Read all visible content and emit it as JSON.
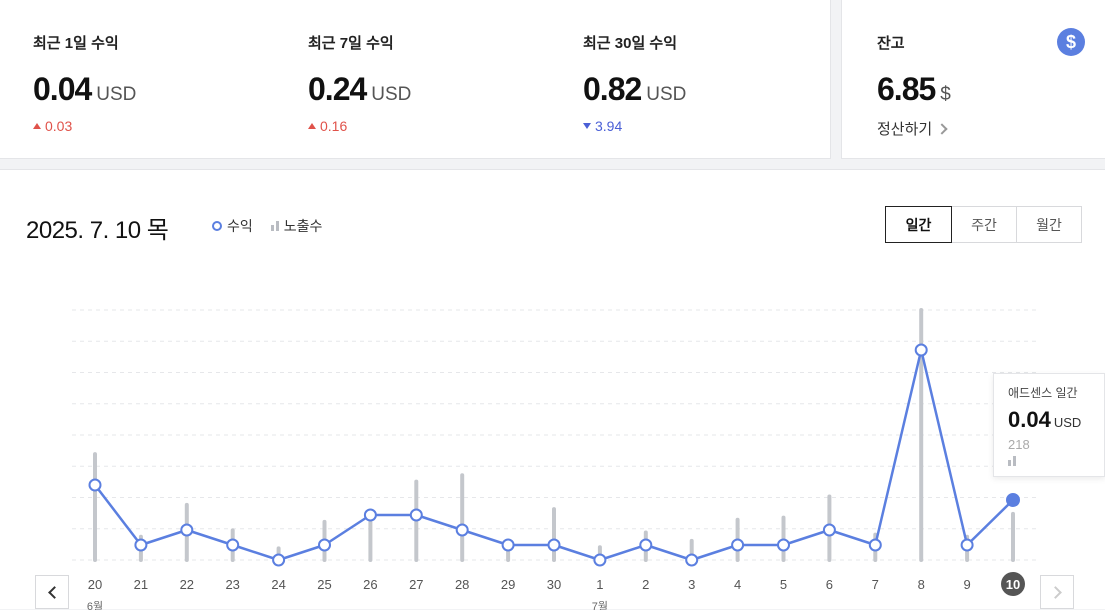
{
  "stats": [
    {
      "label": "최근 1일 수익",
      "value": "0.04",
      "unit": "USD",
      "delta": "0.03",
      "direction": "up"
    },
    {
      "label": "최근 7일 수익",
      "value": "0.24",
      "unit": "USD",
      "delta": "0.16",
      "direction": "up"
    },
    {
      "label": "최근 30일 수익",
      "value": "0.82",
      "unit": "USD",
      "delta": "3.94",
      "direction": "down"
    }
  ],
  "balance": {
    "label": "잔고",
    "value": "6.85",
    "unit": "$",
    "settle_label": "정산하기",
    "icon": "$"
  },
  "panel": {
    "date_title": "2025. 7. 10 목",
    "legend_revenue": "수익",
    "legend_impressions": "노출수",
    "segments": [
      "일간",
      "주간",
      "월간"
    ],
    "active_segment": 0
  },
  "tooltip": {
    "title": "애드센스 일간",
    "value": "0.04",
    "unit": "USD",
    "impressions": "218"
  },
  "colors": {
    "line": "#5b7fe0",
    "bar": "#c4c7cc",
    "up": "#e0524a",
    "down": "#4a5fd6"
  },
  "chart_data": {
    "type": "line",
    "categories": [
      "20",
      "21",
      "22",
      "23",
      "24",
      "25",
      "26",
      "27",
      "28",
      "29",
      "30",
      "1",
      "2",
      "3",
      "4",
      "5",
      "6",
      "7",
      "8",
      "9",
      "10"
    ],
    "month_labels": [
      {
        "at": "20",
        "label": "6월"
      },
      {
        "at": "1",
        "label": "7월"
      }
    ],
    "selected": "10",
    "series": [
      {
        "name": "수익",
        "type": "line",
        "values": [
          0.05,
          0.01,
          0.02,
          0.01,
          0.0,
          0.01,
          0.03,
          0.03,
          0.02,
          0.01,
          0.01,
          0.0,
          0.01,
          0.0,
          0.01,
          0.01,
          0.02,
          0.01,
          0.14,
          0.01,
          0.04
        ]
      },
      {
        "name": "노출수",
        "type": "bar",
        "values": [
          500,
          110,
          260,
          140,
          55,
          180,
          180,
          370,
          400,
          90,
          240,
          60,
          130,
          90,
          190,
          200,
          300,
          120,
          1180,
          110,
          218
        ]
      }
    ],
    "revenue_ylim": [
      0,
      0.16
    ],
    "impressions_ylim": [
      0,
      1180
    ],
    "grid": true
  }
}
